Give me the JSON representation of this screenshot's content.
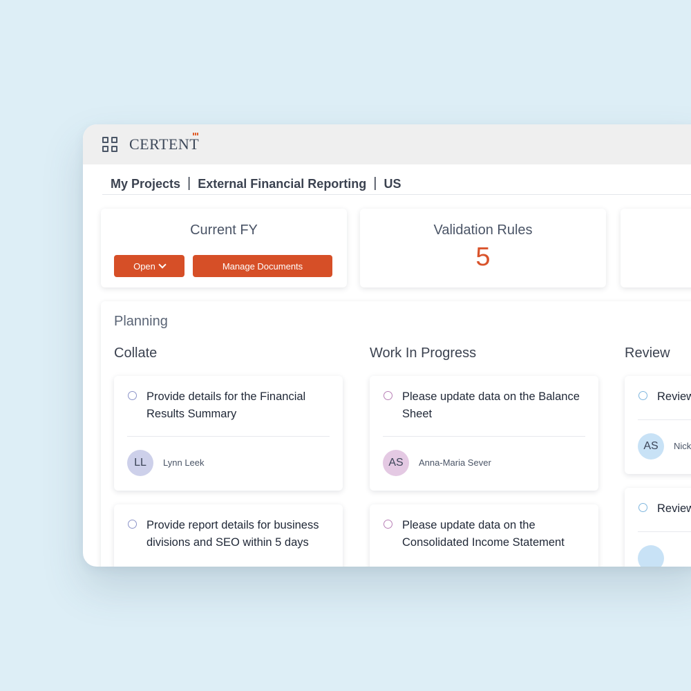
{
  "app": {
    "logo_text": "CERTENT"
  },
  "breadcrumb": [
    "My Projects",
    "External Financial Reporting",
    "US"
  ],
  "breadcrumb_sep": "|",
  "stats": {
    "current_fy": {
      "title": "Current FY",
      "open_label": "Open",
      "manage_label": "Manage Documents"
    },
    "validation": {
      "title": "Validation Rules",
      "value": "5"
    }
  },
  "planning": {
    "title": "Planning",
    "columns": [
      {
        "title": "Collate",
        "tasks": [
          {
            "text": "Provide details for the Financial Results Summary",
            "initials": "LL",
            "assignee": "Lynn Leek"
          },
          {
            "text": "Provide report details for business divisions and SEO within 5 days"
          }
        ]
      },
      {
        "title": "Work In Progress",
        "tasks": [
          {
            "text": "Please update data on the Balance Sheet",
            "initials": "AS",
            "assignee": "Anna-Maria Sever"
          },
          {
            "text": "Please update data on the Consolidated Income Statement"
          }
        ]
      },
      {
        "title": "Review",
        "tasks": [
          {
            "text": "Review",
            "initials": "AS",
            "assignee": "Nick"
          },
          {
            "text": "Review"
          }
        ]
      }
    ]
  },
  "colors": {
    "accent": "#d64f27",
    "collate_circle": "#8b93c8",
    "wip_circle": "#b87fb6",
    "review_circle": "#7fb6de",
    "avatar_ll": "#cdd0ea",
    "avatar_as_wip": "#e4c9e3",
    "avatar_as_review": "#c8e2f6"
  }
}
